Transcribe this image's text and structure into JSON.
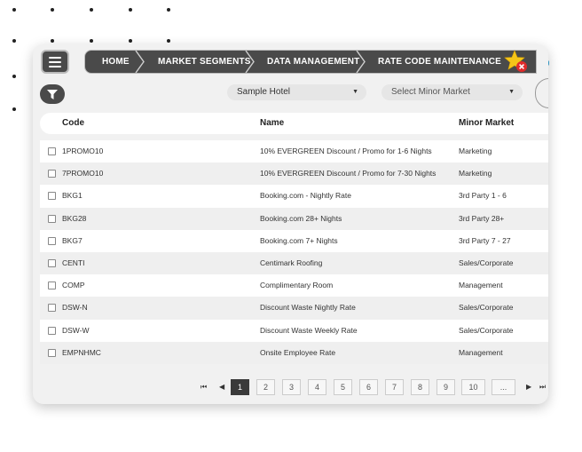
{
  "header": {
    "breadcrumbs": [
      "HOME",
      "MARKET SEGMENTS",
      "DATA MANAGEMENT",
      "RATE CODE MAINTENANCE"
    ]
  },
  "filters": {
    "hotel": "Sample Hotel",
    "minor_market_placeholder": "Select Minor Market"
  },
  "table": {
    "columns": [
      "Code",
      "Name",
      "Minor Market"
    ],
    "rows": [
      {
        "code": "1PROMO10",
        "name": "10% EVERGREEN Discount / Promo for 1-6 Nights",
        "market": "Marketing"
      },
      {
        "code": "7PROMO10",
        "name": "10% EVERGREEN Discount / Promo for 7-30 Nights",
        "market": "Marketing"
      },
      {
        "code": "BKG1",
        "name": "Booking.com - Nightly Rate",
        "market": "3rd Party 1 - 6"
      },
      {
        "code": "BKG28",
        "name": "Booking.com 28+ Nights",
        "market": "3rd Party 28+"
      },
      {
        "code": "BKG7",
        "name": "Booking.com 7+ Nights",
        "market": "3rd Party 7 - 27"
      },
      {
        "code": "CENTI",
        "name": "Centimark Roofing",
        "market": "Sales/Corporate"
      },
      {
        "code": "COMP",
        "name": "Complimentary Room",
        "market": "Management"
      },
      {
        "code": "DSW-N",
        "name": "Discount Waste Nightly Rate",
        "market": "Sales/Corporate"
      },
      {
        "code": "DSW-W",
        "name": "Discount Waste Weekly Rate",
        "market": "Sales/Corporate"
      },
      {
        "code": "EMPNHMC",
        "name": "Onsite Employee Rate",
        "market": "Management"
      }
    ]
  },
  "pagination": {
    "first": "⏮",
    "prev": "◀",
    "pages": [
      "1",
      "2",
      "3",
      "4",
      "5",
      "6",
      "7",
      "8",
      "9",
      "10",
      "..."
    ],
    "current": "1",
    "next": "▶",
    "last": "⏭"
  },
  "colors": {
    "dark": "#4a4a4a",
    "star": "#f5c518",
    "badge": "#e02b2b"
  }
}
